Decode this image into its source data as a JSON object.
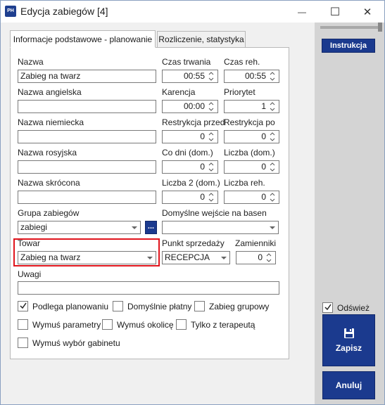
{
  "window": {
    "title": "Edycja zabiegów [4]",
    "app_icon_text": "PH"
  },
  "titlebar": {
    "minimize": "—",
    "maximize": "☐",
    "close": "✕"
  },
  "tabs": [
    {
      "label": "Informacje podstawowe - planowanie",
      "active": true
    },
    {
      "label": "Rozliczenie, statystyka",
      "active": false
    }
  ],
  "form": {
    "nazwa": {
      "label": "Nazwa",
      "value": "Zabieg na twarz"
    },
    "nazwa_angielska": {
      "label": "Nazwa angielska",
      "value": ""
    },
    "nazwa_niemiecka": {
      "label": "Nazwa niemiecka",
      "value": ""
    },
    "nazwa_rosyjska": {
      "label": "Nazwa rosyjska",
      "value": ""
    },
    "nazwa_skrocona": {
      "label": "Nazwa skrócona",
      "value": ""
    },
    "czas_trwania": {
      "label": "Czas trwania",
      "value": "00:55"
    },
    "czas_reh": {
      "label": "Czas reh.",
      "value": "00:55"
    },
    "karencja": {
      "label": "Karencja",
      "value": "00:00"
    },
    "priorytet": {
      "label": "Priorytet",
      "value": "1"
    },
    "restrykcja_przed": {
      "label": "Restrykcja przed",
      "value": "0"
    },
    "restrykcja_po": {
      "label": "Restrykcja po",
      "value": "0"
    },
    "co_dni": {
      "label": "Co dni (dom.)",
      "value": "0"
    },
    "liczba_dom": {
      "label": "Liczba (dom.)",
      "value": "0"
    },
    "liczba2_dom": {
      "label": "Liczba 2 (dom.)",
      "value": "0"
    },
    "liczba_reh": {
      "label": "Liczba reh.",
      "value": "0"
    },
    "grupa_zabiegow": {
      "label": "Grupa zabiegów",
      "value": "zabiegi",
      "more_button": "..."
    },
    "domyslne_wejscie": {
      "label": "Domyślne wejście na basen",
      "value": ""
    },
    "towar": {
      "label": "Towar",
      "value": "Zabieg na twarz"
    },
    "punkt_sprzedazy": {
      "label": "Punkt sprzedaży",
      "value": "RECEPCJA"
    },
    "zamienniki": {
      "label": "Zamienniki",
      "value": "0"
    },
    "uwagi": {
      "label": "Uwagi",
      "value": ""
    }
  },
  "checkboxes": {
    "podlega_planowaniu": {
      "label": "Podlega planowaniu",
      "checked": true
    },
    "domyslnie_platny": {
      "label": "Domyślnie płatny",
      "checked": false
    },
    "zabieg_grupowy": {
      "label": "Zabieg grupowy",
      "checked": false
    },
    "wymus_parametry": {
      "label": "Wymuś parametry",
      "checked": false
    },
    "wymus_okolice": {
      "label": "Wymuś okolicę",
      "checked": false
    },
    "tylko_z_terapeuta": {
      "label": "Tylko z terapeutą",
      "checked": false
    },
    "wymus_wybor_gabinetu": {
      "label": "Wymuś wybór gabinetu",
      "checked": false
    }
  },
  "side": {
    "instrukcja": "Instrukcja",
    "odswiez": {
      "label": "Odśwież",
      "checked": true
    },
    "zapisz": "Zapisz",
    "anuluj": "Anuluj"
  },
  "colors": {
    "accent": "#1b3a8e",
    "highlight": "#e0141c",
    "side_panel": "#d4d4d4"
  }
}
